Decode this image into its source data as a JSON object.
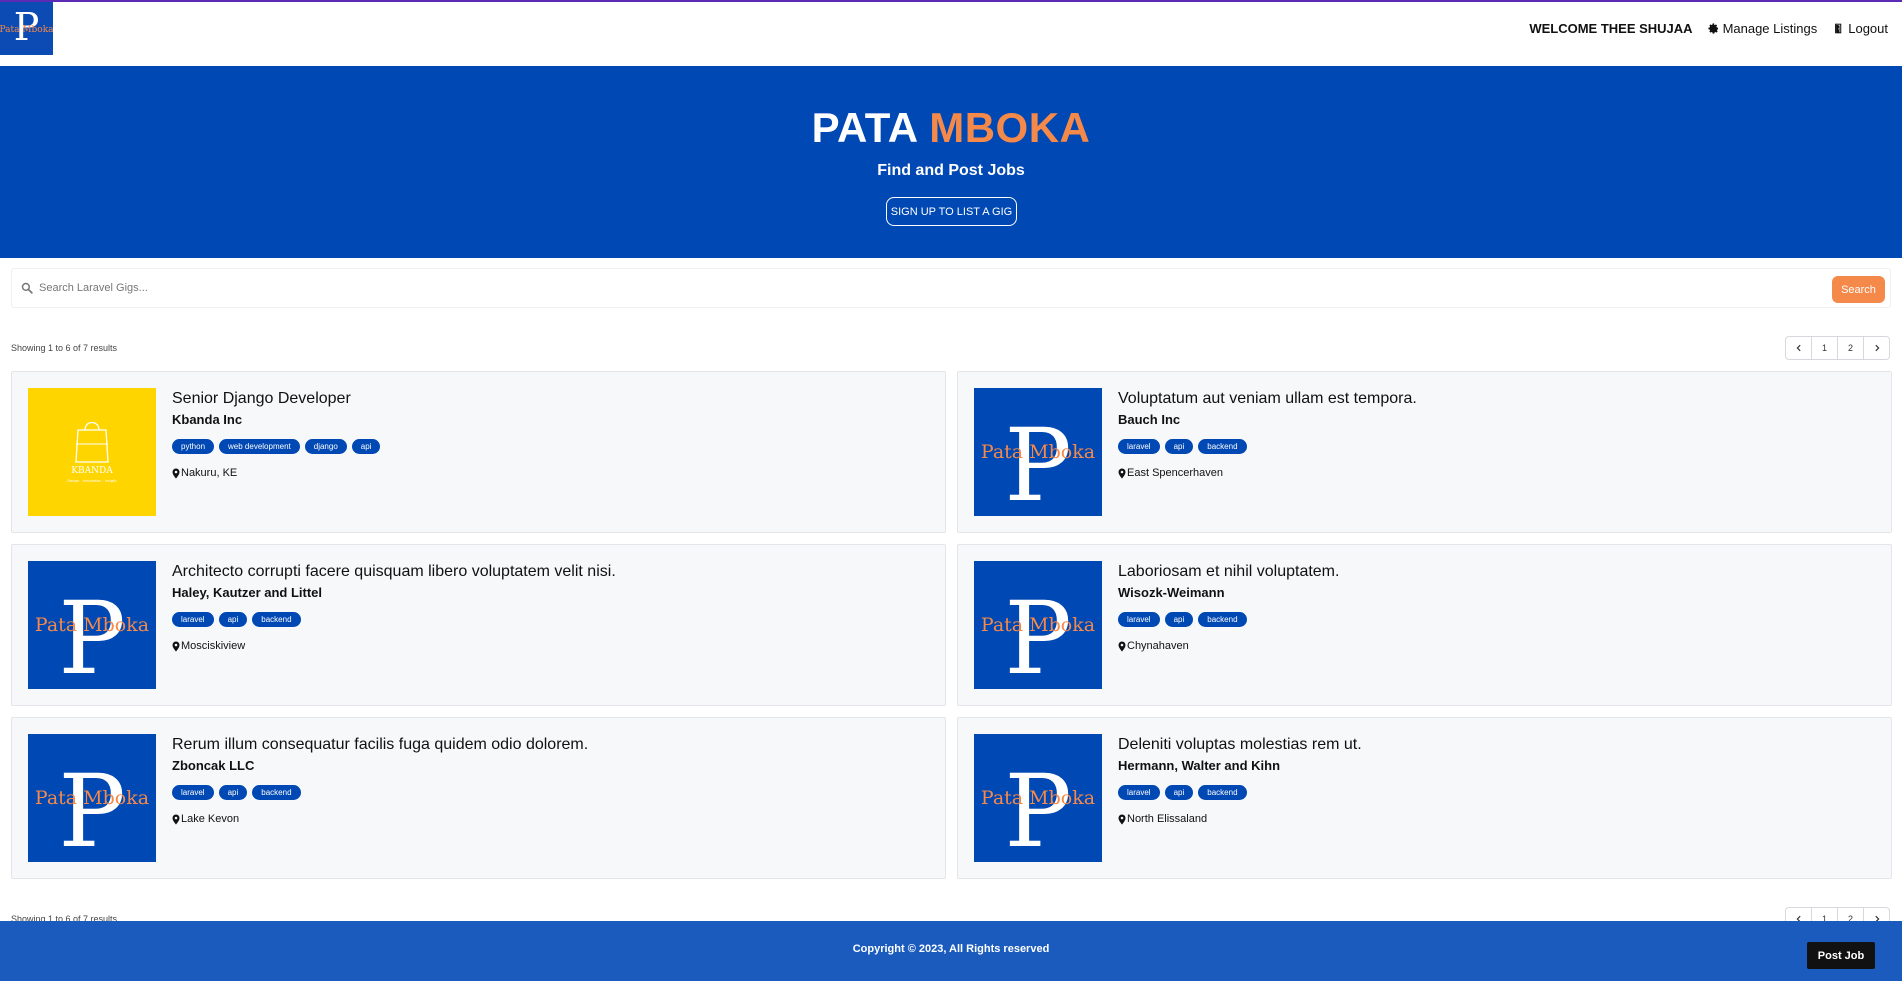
{
  "nav": {
    "logo_text": "Pata Mboka",
    "welcome": "Welcome Thee Shujaa",
    "manage_label": "Manage Listings",
    "logout_label": "Logout"
  },
  "hero": {
    "title_main": "PATA",
    "title_accent": "MBOKA",
    "subtitle": "Find and Post Jobs",
    "cta_label": "Sign Up to List a Gig"
  },
  "search": {
    "placeholder": "Search Laravel Gigs...",
    "button_label": "Search"
  },
  "results": {
    "summary": "Showing 1 to 6 of 7 results",
    "pages": [
      "1",
      "2"
    ]
  },
  "listings": [
    {
      "title": "Senior Django Developer",
      "company": "Kbanda Inc",
      "tags": [
        "python",
        "web development",
        "django",
        "api"
      ],
      "location": "Nakuru, KE",
      "logo": "kbanda",
      "logo_text": "KBANDA",
      "logo_tagline": "Design · Innovation · Insight"
    },
    {
      "title": "Voluptatum aut veniam ullam est tempora.",
      "company": "Bauch Inc",
      "tags": [
        "laravel",
        "api",
        "backend"
      ],
      "location": "East Spencerhaven",
      "logo": "pata"
    },
    {
      "title": "Architecto corrupti facere quisquam libero voluptatem velit nisi.",
      "company": "Haley, Kautzer and Littel",
      "tags": [
        "laravel",
        "api",
        "backend"
      ],
      "location": "Mosciskiview",
      "logo": "pata"
    },
    {
      "title": "Laboriosam et nihil voluptatem.",
      "company": "Wisozk-Weimann",
      "tags": [
        "laravel",
        "api",
        "backend"
      ],
      "location": "Chynahaven",
      "logo": "pata"
    },
    {
      "title": "Rerum illum consequatur facilis fuga quidem odio dolorem.",
      "company": "Zboncak LLC",
      "tags": [
        "laravel",
        "api",
        "backend"
      ],
      "location": "Lake Kevon",
      "logo": "pata"
    },
    {
      "title": "Deleniti voluptas molestias rem ut.",
      "company": "Hermann, Walter and Kihn",
      "tags": [
        "laravel",
        "api",
        "backend"
      ],
      "location": "North Elissaland",
      "logo": "pata"
    }
  ],
  "footer": {
    "copyright": "Copyright © 2023, All Rights reserved",
    "post_job_label": "Post Job"
  },
  "colors": {
    "brand_blue": "#0048b3",
    "accent_orange": "#f5894a",
    "kbanda_yellow": "#ffd500"
  },
  "icons": [
    "gear-icon",
    "door-icon",
    "search-icon",
    "location-pin-icon",
    "chevron-left-icon",
    "chevron-right-icon"
  ]
}
